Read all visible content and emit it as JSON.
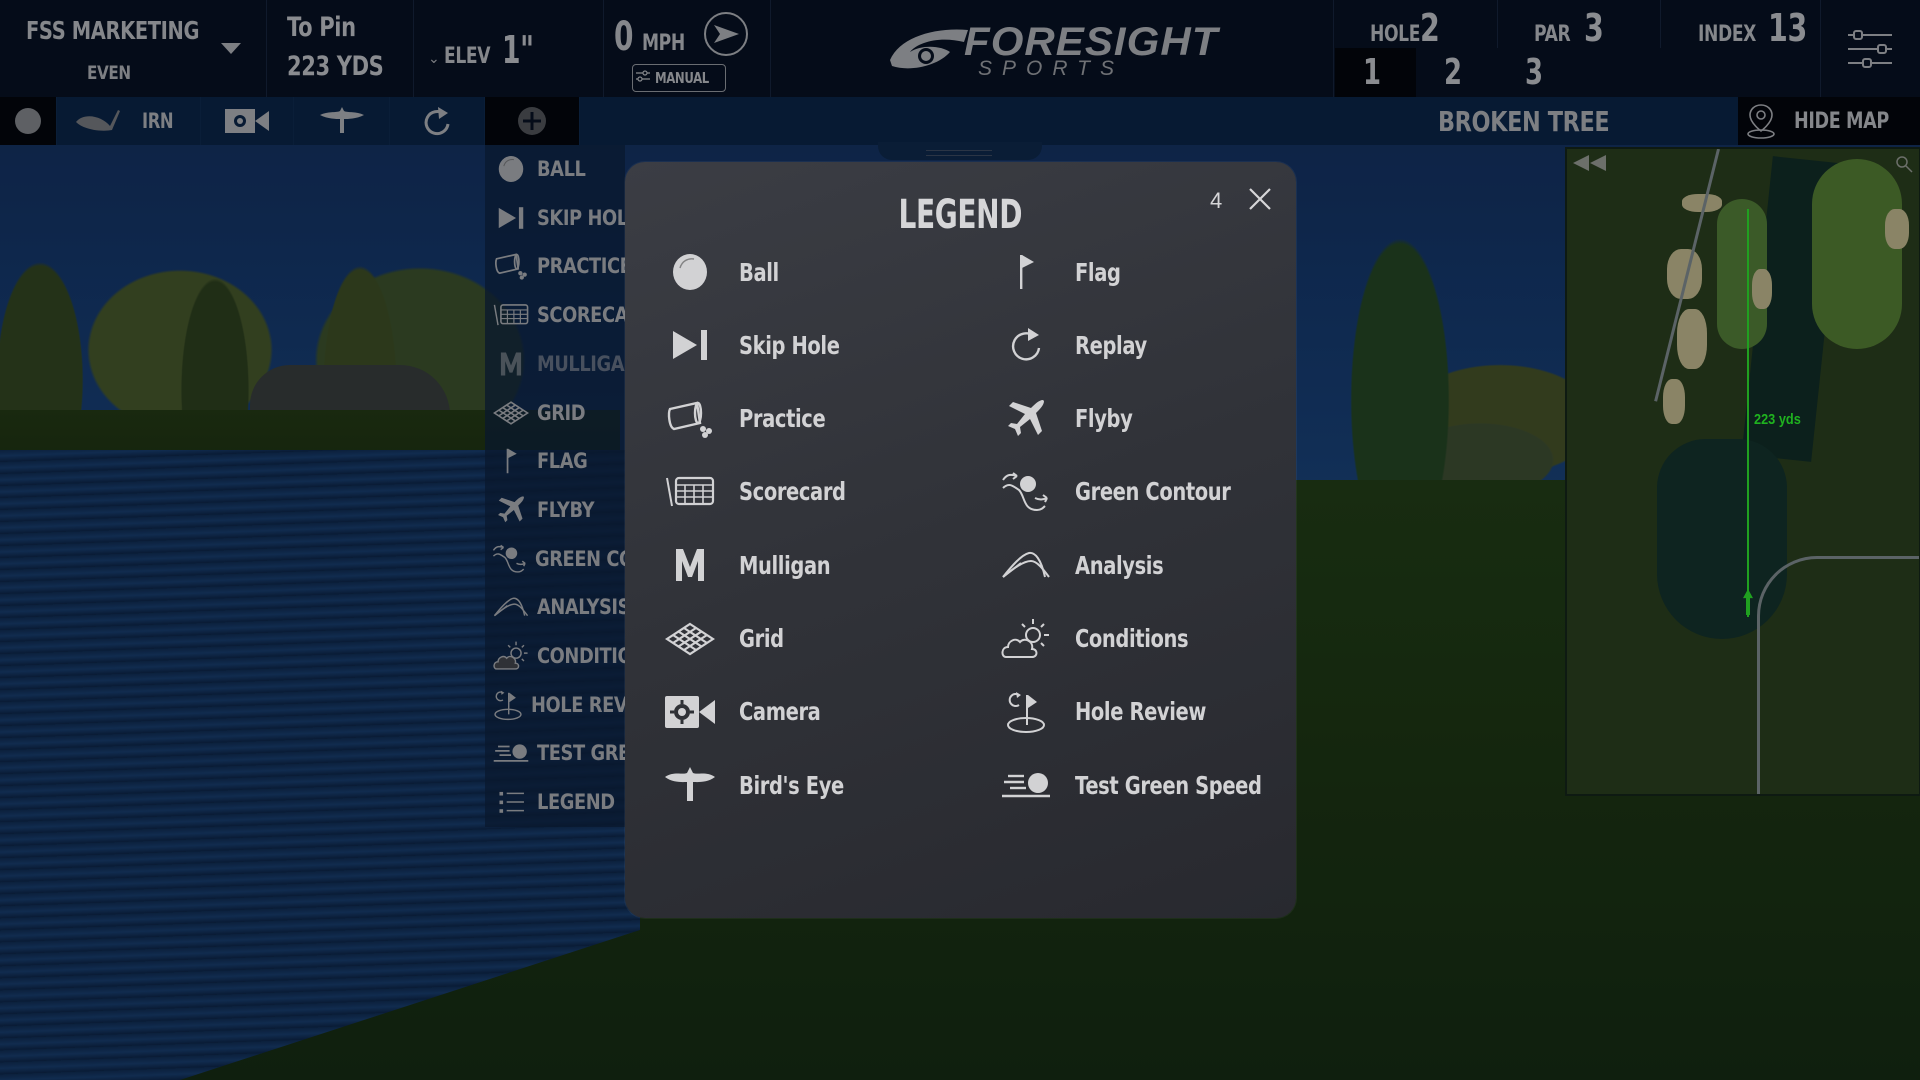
{
  "header": {
    "player_name": "FSS MARKETING",
    "player_score": "EVEN",
    "to_pin_label": "To Pin",
    "to_pin_value": "223 YDS",
    "elev_label": "ELEV",
    "elev_value": "1\"",
    "wind_speed": "0",
    "wind_unit": "MPH",
    "wind_mode_label": "MANUAL",
    "brand_name": "FORESIGHT",
    "brand_sub": "SPORTS",
    "hole_label": "HOLE",
    "hole_value": "2",
    "par_label": "PAR",
    "par_value": "3",
    "index_label": "INDEX",
    "index_value": "13",
    "hole_tabs": [
      {
        "label": "1",
        "active": true
      },
      {
        "label": "2",
        "active": false
      },
      {
        "label": "3",
        "active": false
      }
    ]
  },
  "toolbar": {
    "club_label": "IRN",
    "course_name": "BROKEN TREE",
    "hide_map_label": "HIDE MAP"
  },
  "side_menu": {
    "items": [
      {
        "label": "BALL",
        "icon": "ball-icon"
      },
      {
        "label": "SKIP HOLE",
        "icon": "skip-hole-icon"
      },
      {
        "label": "PRACTICE",
        "icon": "practice-icon"
      },
      {
        "label": "SCORECARD",
        "icon": "scorecard-icon"
      },
      {
        "label": "MULLIGAN",
        "icon": "mulligan-icon",
        "disabled": true
      },
      {
        "label": "GRID",
        "icon": "grid-icon"
      },
      {
        "label": "FLAG",
        "icon": "flag-icon"
      },
      {
        "label": "FLYBY",
        "icon": "flyby-icon"
      },
      {
        "label": "GREEN CONTOUR",
        "icon": "green-contour-icon"
      },
      {
        "label": "ANALYSIS",
        "icon": "analysis-icon"
      },
      {
        "label": "CONDITIONS",
        "icon": "conditions-icon"
      },
      {
        "label": "HOLE REVIEW",
        "icon": "hole-review-icon"
      },
      {
        "label": "TEST GREEN SPEED",
        "icon": "test-green-speed-icon"
      },
      {
        "label": "LEGEND",
        "icon": "legend-icon"
      }
    ]
  },
  "legend": {
    "title": "LEGEND",
    "countdown": "4",
    "left_column": [
      {
        "label": "Ball",
        "icon": "ball-icon"
      },
      {
        "label": "Skip Hole",
        "icon": "skip-hole-icon"
      },
      {
        "label": "Practice",
        "icon": "practice-icon"
      },
      {
        "label": "Scorecard",
        "icon": "scorecard-icon"
      },
      {
        "label": "Mulligan",
        "icon": "mulligan-icon"
      },
      {
        "label": "Grid",
        "icon": "grid-icon"
      },
      {
        "label": "Camera",
        "icon": "camera-icon"
      },
      {
        "label": "Bird's Eye",
        "icon": "birds-eye-icon"
      }
    ],
    "right_column": [
      {
        "label": "Flag",
        "icon": "flag-icon"
      },
      {
        "label": "Replay",
        "icon": "replay-icon"
      },
      {
        "label": "Flyby",
        "icon": "flyby-icon"
      },
      {
        "label": "Green Contour",
        "icon": "green-contour-icon"
      },
      {
        "label": "Analysis",
        "icon": "analysis-icon"
      },
      {
        "label": "Conditions",
        "icon": "conditions-icon"
      },
      {
        "label": "Hole Review",
        "icon": "hole-review-icon"
      },
      {
        "label": "Test Green Speed",
        "icon": "test-green-speed-icon"
      }
    ]
  },
  "minimap": {
    "distance_label": "223 yds",
    "aim_line_color": "#20a020"
  },
  "colors": {
    "header_bg": "#050c19",
    "toolbar_bg": "#071a33",
    "legend_bg": "#303238",
    "legend_text": "#d2d2d4"
  }
}
